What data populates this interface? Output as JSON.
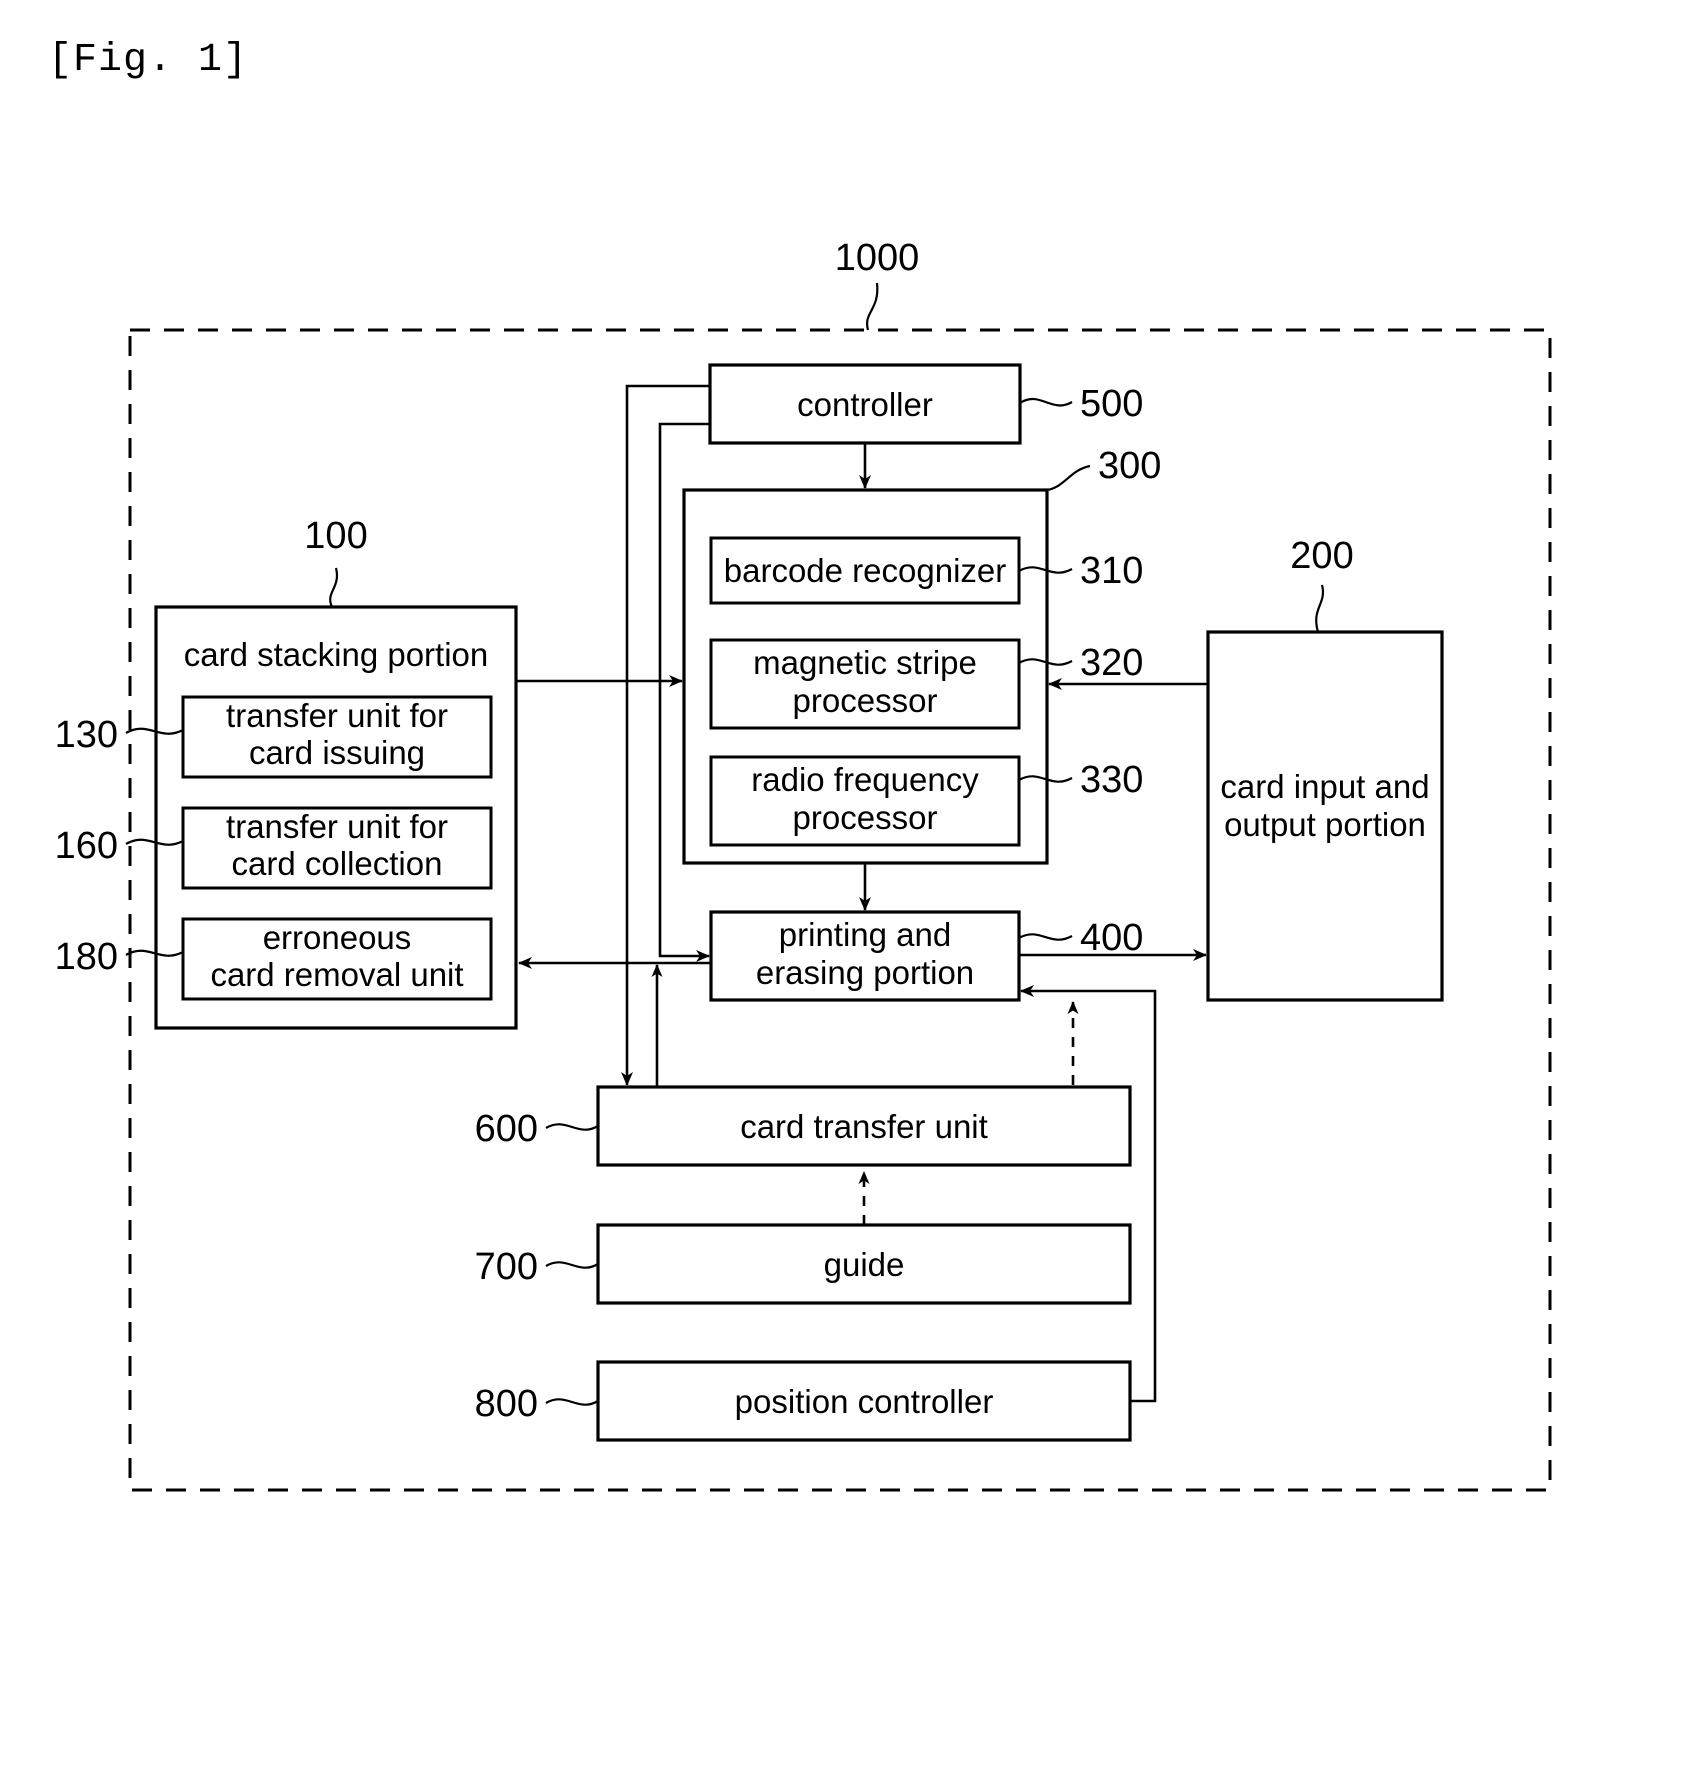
{
  "figure": {
    "label": "[Fig. 1]"
  },
  "system": {
    "outer_ref": "1000"
  },
  "blocks": {
    "controller": {
      "label": "controller",
      "ref": "500"
    },
    "processor_group": {
      "ref": "300"
    },
    "barcode_recognizer": {
      "label": "barcode recognizer",
      "ref": "310"
    },
    "magnetic_stripe_processor": {
      "label_line1": "magnetic stripe",
      "label_line2": "processor",
      "ref": "320"
    },
    "radio_frequency_processor": {
      "label_line1": "radio frequency",
      "label_line2": "processor",
      "ref": "330"
    },
    "card_stacking_portion": {
      "label": "card stacking portion",
      "ref": "100"
    },
    "transfer_unit_card_issuing": {
      "label_line1": "transfer unit for",
      "label_line2": "card issuing",
      "ref": "130"
    },
    "transfer_unit_card_collection": {
      "label_line1": "transfer unit for",
      "label_line2": "card collection",
      "ref": "160"
    },
    "erroneous_card_removal_unit": {
      "label_line1": "erroneous",
      "label_line2": "card removal unit",
      "ref": "180"
    },
    "card_input_output_portion": {
      "label_line1": "card input and",
      "label_line2": "output portion",
      "ref": "200"
    },
    "printing_erasing_portion": {
      "label_line1": "printing and",
      "label_line2": "erasing portion",
      "ref": "400"
    },
    "card_transfer_unit": {
      "label": "card transfer unit",
      "ref": "600"
    },
    "guide": {
      "label": "guide",
      "ref": "700"
    },
    "position_controller": {
      "label": "position controller",
      "ref": "800"
    }
  },
  "colors": {
    "stroke": "#000000",
    "background": "#ffffff"
  }
}
